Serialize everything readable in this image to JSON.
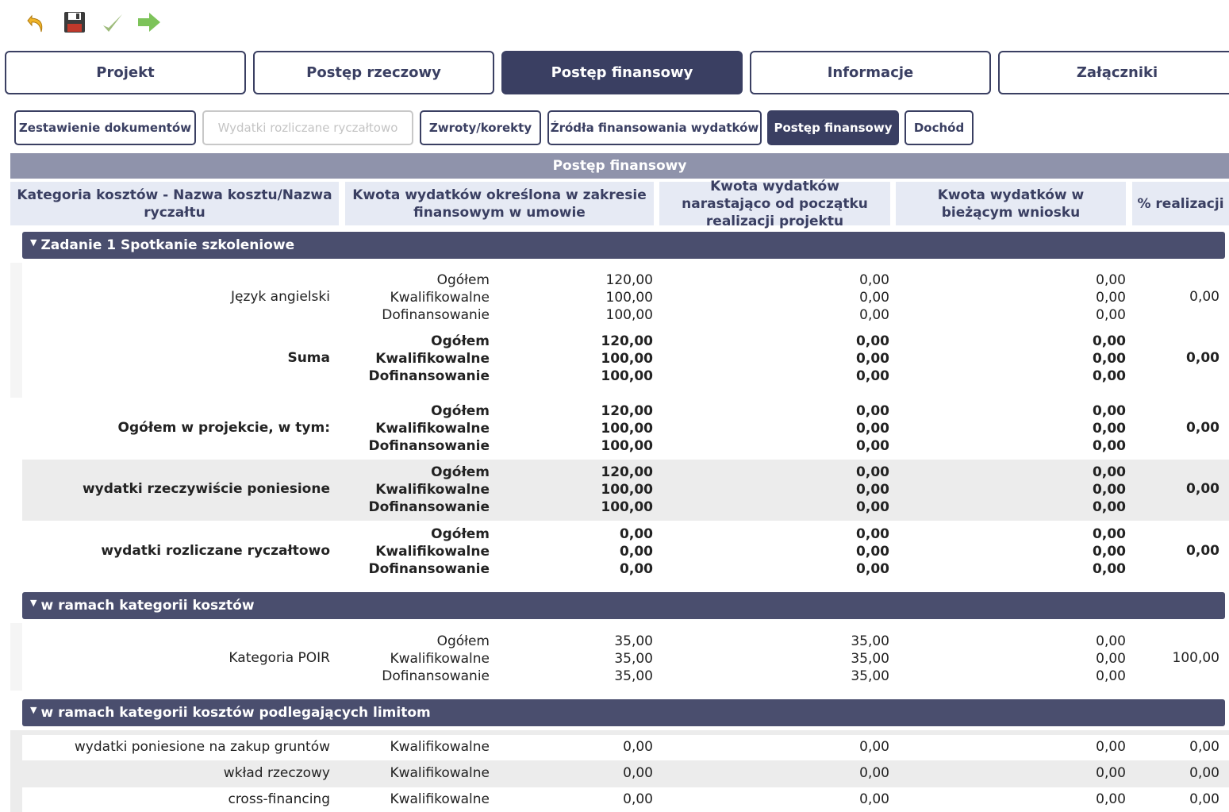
{
  "toolbar": {
    "icons": [
      "undo-icon",
      "save-icon",
      "check-icon",
      "forward-arrow-icon"
    ]
  },
  "main_tabs": [
    {
      "label": "Projekt",
      "active": false
    },
    {
      "label": "Postęp rzeczowy",
      "active": false
    },
    {
      "label": "Postęp finansowy",
      "active": true
    },
    {
      "label": "Informacje",
      "active": false
    },
    {
      "label": "Załączniki",
      "active": false
    }
  ],
  "sub_tabs": [
    {
      "label": "Zestawienie dokumentów",
      "state": "normal"
    },
    {
      "label": "Wydatki rozliczane ryczałtowo",
      "state": "disabled"
    },
    {
      "label": "Zwroty/korekty",
      "state": "normal"
    },
    {
      "label": "Źródła finansowania wydatków",
      "state": "normal"
    },
    {
      "label": "Postęp finansowy",
      "state": "active"
    },
    {
      "label": "Dochód",
      "state": "normal"
    }
  ],
  "table": {
    "title": "Postęp finansowy",
    "headers": {
      "category": "Kategoria kosztów - Nazwa kosztu/Nazwa ryczałtu",
      "amount_contract": "Kwota wydatków określona w zakresie finansowym w umowie",
      "amount_cumulative": "Kwota wydatków narastająco od początku realizacji projektu",
      "amount_current": "Kwota wydatków w bieżącym wniosku",
      "realization": "% realizacji"
    },
    "kinds": [
      "Ogółem",
      "Kwalifikowalne",
      "Dofinansowanie"
    ],
    "section1": {
      "title": "Zadanie 1 Spotkanie szkoleniowe",
      "rows": [
        {
          "label": "Język angielski",
          "contract": [
            "120,00",
            "100,00",
            "100,00"
          ],
          "cumulative": [
            "0,00",
            "0,00",
            "0,00"
          ],
          "current": [
            "0,00",
            "0,00",
            "0,00"
          ],
          "pct": "0,00"
        },
        {
          "label": "Suma",
          "contract": [
            "120,00",
            "100,00",
            "100,00"
          ],
          "cumulative": [
            "0,00",
            "0,00",
            "0,00"
          ],
          "current": [
            "0,00",
            "0,00",
            "0,00"
          ],
          "pct": "0,00"
        },
        {
          "label": "Ogółem w projekcie, w tym:",
          "contract": [
            "120,00",
            "100,00",
            "100,00"
          ],
          "cumulative": [
            "0,00",
            "0,00",
            "0,00"
          ],
          "current": [
            "0,00",
            "0,00",
            "0,00"
          ],
          "pct": "0,00"
        },
        {
          "label": "wydatki rzeczywiście poniesione",
          "contract": [
            "120,00",
            "100,00",
            "100,00"
          ],
          "cumulative": [
            "0,00",
            "0,00",
            "0,00"
          ],
          "current": [
            "0,00",
            "0,00",
            "0,00"
          ],
          "pct": "0,00"
        },
        {
          "label": "wydatki rozliczane ryczałtowo",
          "contract": [
            "0,00",
            "0,00",
            "0,00"
          ],
          "cumulative": [
            "0,00",
            "0,00",
            "0,00"
          ],
          "current": [
            "0,00",
            "0,00",
            "0,00"
          ],
          "pct": "0,00"
        }
      ]
    },
    "section2": {
      "title": "w ramach kategorii kosztów",
      "rows": [
        {
          "label": "Kategoria POIR",
          "contract": [
            "35,00",
            "35,00",
            "35,00"
          ],
          "cumulative": [
            "35,00",
            "35,00",
            "35,00"
          ],
          "current": [
            "0,00",
            "0,00",
            "0,00"
          ],
          "pct": "100,00"
        }
      ]
    },
    "section3": {
      "title": "w ramach kategorii kosztów podlegających limitom",
      "rows": [
        {
          "label": "wydatki poniesione na zakup gruntów",
          "kind": "Kwalifikowalne",
          "contract": "0,00",
          "cumulative": "0,00",
          "current": "0,00",
          "pct": "0,00"
        },
        {
          "label": "wkład rzeczowy",
          "kind": "Kwalifikowalne",
          "contract": "0,00",
          "cumulative": "0,00",
          "current": "0,00",
          "pct": "0,00"
        },
        {
          "label": "cross-financing",
          "kind": "Kwalifikowalne",
          "contract": "0,00",
          "cumulative": "0,00",
          "current": "0,00",
          "pct": "0,00"
        }
      ]
    }
  },
  "colors": {
    "accent": "#3a3f62",
    "section_bar": "#4a4e6e",
    "title_bar": "#8f93ab",
    "header_bg": "#e6eaf4"
  }
}
